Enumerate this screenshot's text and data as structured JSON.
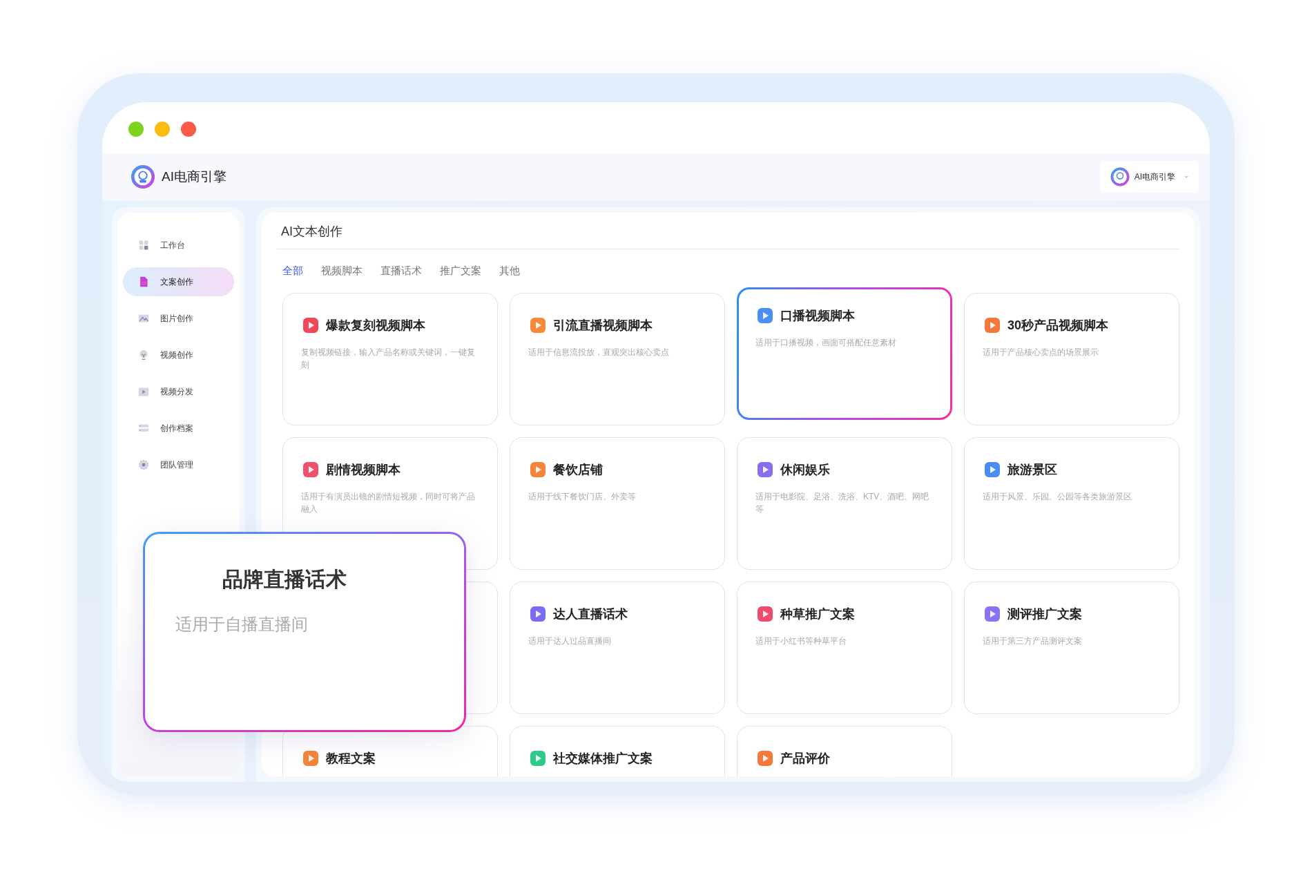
{
  "app": {
    "name": "AI电商引擎",
    "user": "AI电商引擎"
  },
  "sidebar": {
    "items": [
      {
        "label": "工作台",
        "kind": "grid",
        "selected": false
      },
      {
        "label": "文案创作",
        "kind": "doc",
        "selected": true
      },
      {
        "label": "图片创作",
        "kind": "image",
        "selected": false
      },
      {
        "label": "视频创作",
        "kind": "bulb",
        "selected": false
      },
      {
        "label": "视频分发",
        "kind": "play",
        "selected": false
      },
      {
        "label": "创作档案",
        "kind": "list",
        "selected": false
      },
      {
        "label": "团队管理",
        "kind": "gear",
        "selected": false
      }
    ]
  },
  "main": {
    "title": "AI文本创作",
    "tabs": [
      {
        "label": "全部",
        "selected": true
      },
      {
        "label": "视频脚本",
        "selected": false
      },
      {
        "label": "直播话术",
        "selected": false
      },
      {
        "label": "推广文案",
        "selected": false
      },
      {
        "label": "其他",
        "selected": false
      }
    ],
    "cards": [
      {
        "kind": "card",
        "title": "爆款复刻视频脚本",
        "desc": "复制视频链接，输入产品名称或关键词，一键复刻",
        "color": "#f0485a",
        "selected": false
      },
      {
        "kind": "card",
        "title": "引流直播视频脚本",
        "desc": "适用于信息流投放，直观突出核心卖点",
        "color": "#f78a3a",
        "selected": false
      },
      {
        "kind": "card",
        "title": "口播视频脚本",
        "desc": "适用于口播视频，画面可搭配任意素材",
        "color": "#4b8ff5",
        "selected": true
      },
      {
        "kind": "card",
        "title": "30秒产品视频脚本",
        "desc": "适用于产品核心卖点的场景展示",
        "color": "#f5783a",
        "selected": false
      },
      {
        "kind": "card",
        "title": "剧情视频脚本",
        "desc": "适用于有演员出镜的剧情短视频，同时可将产品融入",
        "color": "#f0506a",
        "selected": false
      },
      {
        "kind": "card",
        "title": "餐饮店铺",
        "desc": "适用于线下餐饮门店、外卖等",
        "color": "#f5843a",
        "selected": false
      },
      {
        "kind": "card",
        "title": "休闲娱乐",
        "desc": "适用于电影院、足浴、洗浴、KTV、酒吧、网吧等",
        "color": "#8a6cf0",
        "selected": false
      },
      {
        "kind": "card",
        "title": "旅游景区",
        "desc": "适用于风景、乐园、公园等各类旅游景区",
        "color": "#4a8df2",
        "selected": false
      },
      {
        "kind": "covered"
      },
      {
        "kind": "card",
        "title": "达人直播话术",
        "desc": "适用于达人过品直播间",
        "color": "#7a6cf0",
        "selected": false
      },
      {
        "kind": "card",
        "title": "种草推广文案",
        "desc": "适用于小红书等种草平台",
        "color": "#f04a6a",
        "selected": false
      },
      {
        "kind": "card",
        "title": "测评推广文案",
        "desc": "适用于第三方产品测评文案",
        "color": "#8a72f2",
        "selected": false
      },
      {
        "kind": "card",
        "title": "教程文案",
        "color": "#f5843a",
        "selected": false
      },
      {
        "kind": "card",
        "title": "社交媒体推广文案",
        "color": "#2fc98a",
        "selected": false
      },
      {
        "kind": "card",
        "title": "产品评价",
        "color": "#f5783a",
        "selected": false
      }
    ]
  },
  "popup": {
    "title": "品牌直播话术",
    "desc": "适用于自播直播间"
  }
}
